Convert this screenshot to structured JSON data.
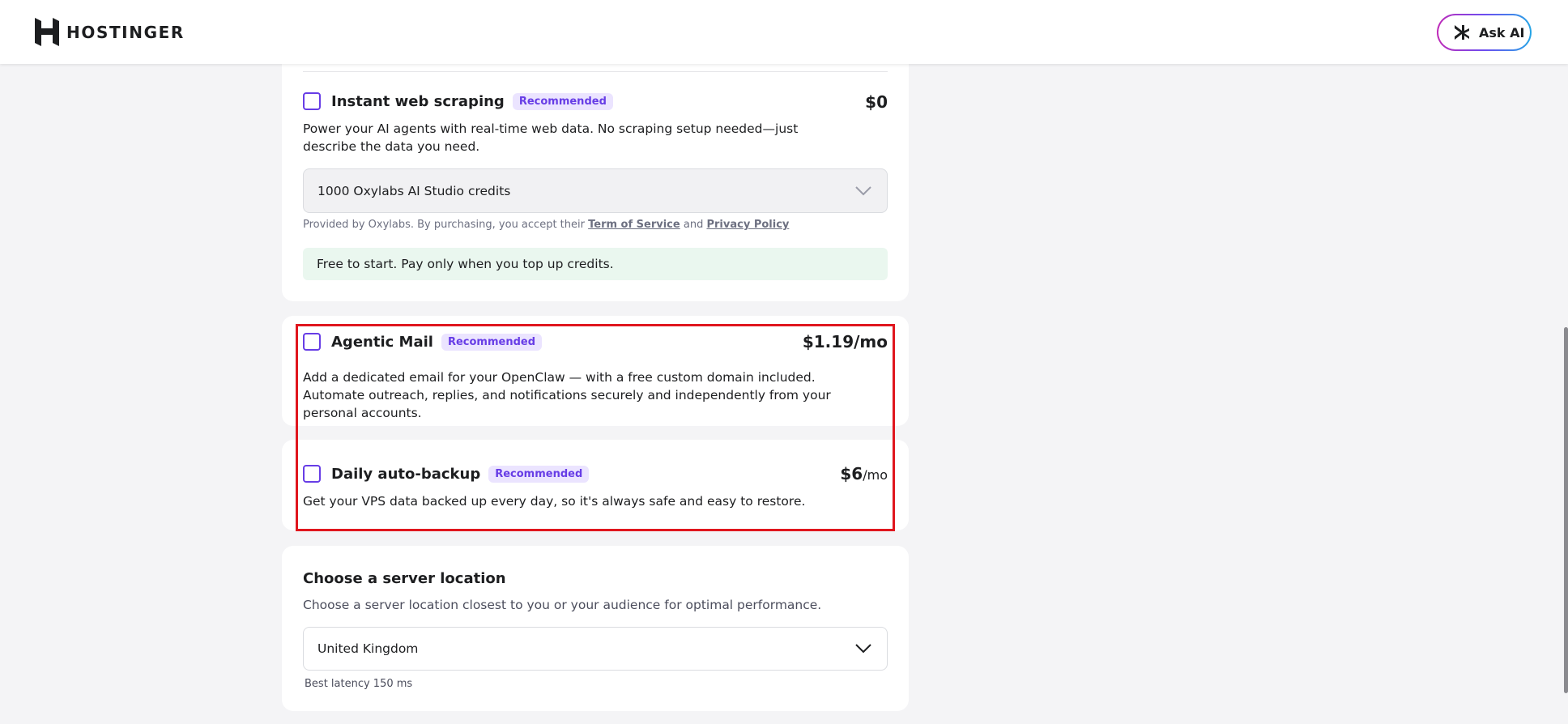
{
  "header": {
    "logo_text": "HOSTINGER",
    "ask_ai_label": "Ask AI"
  },
  "addons": {
    "web_scraping": {
      "title": "Instant web scraping",
      "badge": "Recommended",
      "price": "$0",
      "description": "Power your AI agents with real-time web data. No scraping setup needed—just describe the data you need.",
      "select_value": "1000 Oxylabs AI Studio credits",
      "provided_prefix": "Provided by Oxylabs. By purchasing, you accept their",
      "terms_link": "Term of Service",
      "and_text": "and",
      "privacy_link": "Privacy Policy",
      "info": "Free to start. Pay only when you top up credits."
    },
    "agentic_mail": {
      "title": "Agentic Mail",
      "badge": "Recommended",
      "price_amount": "$1.19",
      "price_unit": "/mo",
      "description": "Add a dedicated email for your OpenClaw — with a free custom domain included. Automate outreach, replies, and notifications securely and independently from your personal accounts."
    },
    "daily_backup": {
      "title": "Daily auto-backup",
      "badge": "Recommended",
      "price_amount": "$6",
      "price_unit": "/mo",
      "description": "Get your VPS data backed up every day, so it's always safe and easy to restore."
    }
  },
  "server_location": {
    "title": "Choose a server location",
    "subtitle": "Choose a server location closest to you or your audience for optimal performance.",
    "selected": "United Kingdom",
    "latency": "Best latency 150 ms"
  },
  "colors": {
    "accent": "#673de6",
    "badge_bg": "#ebe4ff",
    "highlight": "#e0161e",
    "info_bg": "#eaf7ef"
  },
  "icons": {
    "logo": "hostinger-logo-icon",
    "ask_ai": "ai-sparkle-icon",
    "dropdown": "chevron-down-icon"
  }
}
